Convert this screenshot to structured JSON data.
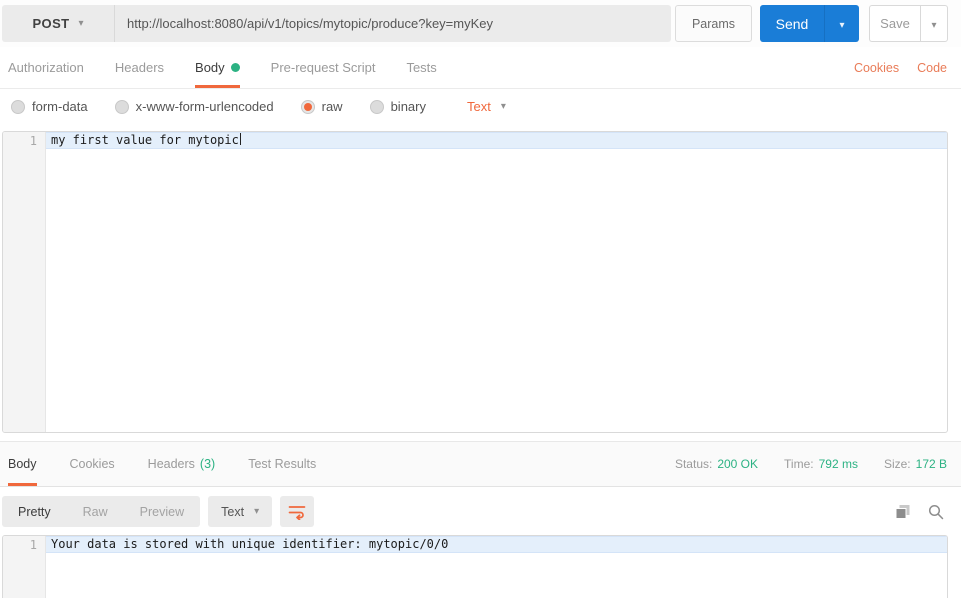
{
  "request_bar": {
    "method": "POST",
    "url": "http://localhost:8080/api/v1/topics/mytopic/produce?key=myKey",
    "params_label": "Params",
    "send_label": "Send",
    "save_label": "Save"
  },
  "request_tabs": {
    "items": [
      {
        "label": "Authorization"
      },
      {
        "label": "Headers"
      },
      {
        "label": "Body"
      },
      {
        "label": "Pre-request Script"
      },
      {
        "label": "Tests"
      }
    ],
    "active": "Body",
    "cookies_label": "Cookies",
    "code_label": "Code"
  },
  "body_type": {
    "options": [
      "form-data",
      "x-www-form-urlencoded",
      "raw",
      "binary"
    ],
    "selected": "raw",
    "format_selected": "Text"
  },
  "request_editor": {
    "line_number": "1",
    "content": "my first value for mytopic"
  },
  "response_meta": {
    "tabs": [
      "Body",
      "Cookies",
      "Headers",
      "Test Results"
    ],
    "active": "Body",
    "headers_count": "(3)",
    "status_label": "Status:",
    "status_value": "200 OK",
    "time_label": "Time:",
    "time_value": "792 ms",
    "size_label": "Size:",
    "size_value": "172 B"
  },
  "response_toolbar": {
    "views": [
      "Pretty",
      "Raw",
      "Preview"
    ],
    "active_view": "Pretty",
    "format_selected": "Text"
  },
  "response_editor": {
    "line_number": "1",
    "content": "Your data is stored with unique identifier: mytopic/0/0"
  },
  "colors": {
    "accent_orange": "#f0683c",
    "send_blue": "#1a7dd7",
    "success_green": "#2cb283"
  }
}
